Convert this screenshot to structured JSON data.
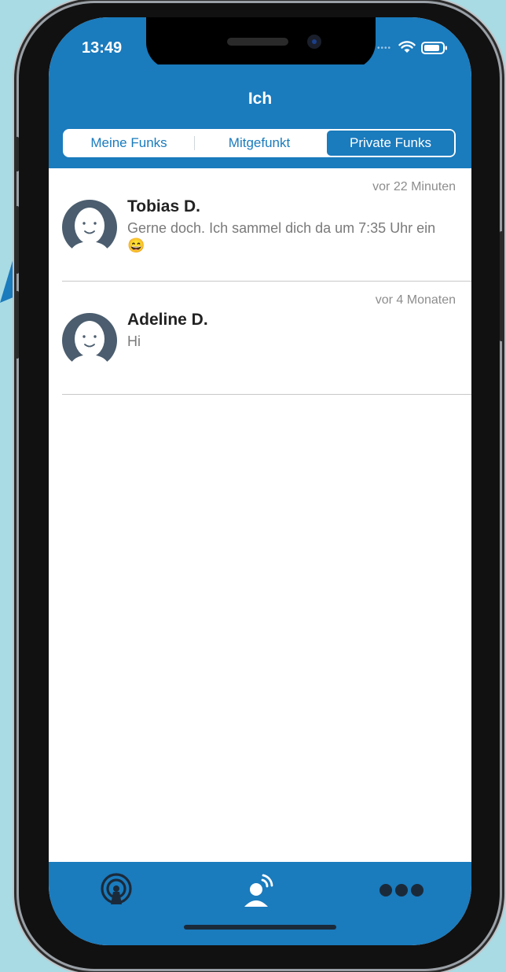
{
  "status_bar": {
    "time": "13:49"
  },
  "header": {
    "title": "Ich",
    "segments": [
      {
        "label": "Meine Funks"
      },
      {
        "label": "Mitgefunkt"
      },
      {
        "label": "Private Funks"
      }
    ],
    "selected_segment": "Private Funks"
  },
  "conversations": [
    {
      "name": "Tobias D.",
      "message": "Gerne doch. Ich sammel dich da um 7:35 Uhr ein 😄",
      "time_ago": "vor 22 Minuten"
    },
    {
      "name": "Adeline D.",
      "message": "Hi",
      "time_ago": "vor 4 Monaten"
    }
  ],
  "tab_bar": {
    "items": [
      {
        "icon": "broadcast-icon"
      },
      {
        "icon": "profile-speaking-icon"
      },
      {
        "icon": "more-dots-icon"
      }
    ]
  },
  "colors": {
    "brand_blue": "#1a7bbd",
    "background": "#a9dbe4"
  }
}
